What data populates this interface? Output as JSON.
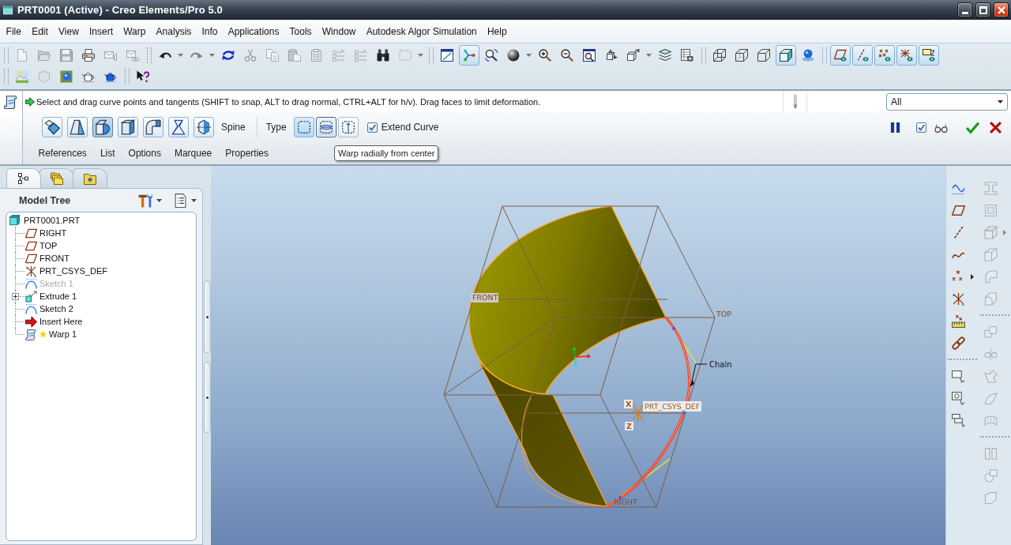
{
  "window": {
    "title": "PRT0001 (Active) - Creo Elements/Pro 5.0"
  },
  "menu": [
    "File",
    "Edit",
    "View",
    "Insert",
    "Warp",
    "Analysis",
    "Info",
    "Applications",
    "Tools",
    "Window",
    "Autodesk Algor Simulation",
    "Help"
  ],
  "toolbar_rows": [
    [
      [
        {
          "kind": "new",
          "on": false,
          "disabled": true,
          "menu": false
        },
        {
          "kind": "open",
          "on": false,
          "disabled": true,
          "menu": false
        },
        {
          "kind": "save",
          "on": false,
          "disabled": true,
          "menu": false
        },
        {
          "kind": "print",
          "on": false,
          "disabled": false,
          "menu": false
        },
        {
          "kind": "mail",
          "on": false,
          "disabled": true,
          "menu": false
        },
        {
          "kind": "mail_link",
          "on": false,
          "disabled": true,
          "menu": false
        }
      ],
      [
        {
          "kind": "undo",
          "on": false,
          "disabled": false,
          "menu": true
        },
        {
          "kind": "redo",
          "on": false,
          "disabled": true,
          "menu": true
        },
        {
          "kind": "regen",
          "on": false,
          "disabled": false,
          "menu": false
        },
        {
          "kind": "cut",
          "on": false,
          "disabled": true,
          "menu": false
        },
        {
          "kind": "copy",
          "on": false,
          "disabled": true,
          "menu": false
        },
        {
          "kind": "paste",
          "on": false,
          "disabled": true,
          "menu": false
        },
        {
          "kind": "paste_special",
          "on": false,
          "disabled": true,
          "menu": false
        },
        {
          "kind": "list_arrows",
          "on": false,
          "disabled": true,
          "menu": false
        },
        {
          "kind": "list_arrows",
          "on": false,
          "disabled": true,
          "menu": false
        },
        {
          "kind": "find",
          "on": false,
          "disabled": false,
          "menu": false
        },
        {
          "kind": "box_select",
          "on": false,
          "disabled": true,
          "menu": true
        }
      ],
      [
        {
          "kind": "repaint",
          "on": false,
          "disabled": false,
          "menu": false
        },
        {
          "kind": "spin",
          "on": true,
          "disabled": false,
          "menu": false
        },
        {
          "kind": "orient",
          "on": false,
          "disabled": false,
          "menu": false
        },
        {
          "kind": "sphere",
          "on": false,
          "disabled": false,
          "menu": true
        },
        {
          "kind": "zoom_in",
          "on": false,
          "disabled": false,
          "menu": false
        },
        {
          "kind": "zoom_out",
          "on": false,
          "disabled": false,
          "menu": false
        },
        {
          "kind": "refit",
          "on": false,
          "disabled": false,
          "menu": false
        },
        {
          "kind": "reorient",
          "on": false,
          "disabled": false,
          "menu": false
        },
        {
          "kind": "views",
          "on": false,
          "disabled": false,
          "menu": true
        },
        {
          "kind": "layers",
          "on": false,
          "disabled": false,
          "menu": false
        },
        {
          "kind": "view_mgr",
          "on": false,
          "disabled": false,
          "menu": false
        }
      ],
      [
        {
          "kind": "wire",
          "on": false,
          "disabled": false,
          "menu": false
        },
        {
          "kind": "hidden",
          "on": false,
          "disabled": false,
          "menu": false
        },
        {
          "kind": "nohidden",
          "on": false,
          "disabled": false,
          "menu": false
        },
        {
          "kind": "shaded",
          "on": true,
          "disabled": false,
          "menu": false
        },
        {
          "kind": "realism",
          "on": false,
          "disabled": false,
          "menu": false
        }
      ],
      [
        {
          "kind": "planes_on",
          "on": true,
          "disabled": false,
          "menu": false
        },
        {
          "kind": "axes_on",
          "on": true,
          "disabled": false,
          "menu": false
        },
        {
          "kind": "points_on",
          "on": true,
          "disabled": false,
          "menu": false
        },
        {
          "kind": "csys_on",
          "on": true,
          "disabled": false,
          "menu": false
        },
        {
          "kind": "notes_on",
          "on": true,
          "disabled": false,
          "menu": false
        }
      ]
    ],
    [
      [
        {
          "kind": "scene",
          "on": false,
          "disabled": false,
          "menu": false
        },
        {
          "kind": "perspective",
          "on": false,
          "disabled": true,
          "menu": false
        },
        {
          "kind": "texture",
          "on": false,
          "disabled": false,
          "menu": false
        },
        {
          "kind": "teapot",
          "on": false,
          "disabled": false,
          "menu": false
        },
        {
          "kind": "teapot_blue",
          "on": false,
          "disabled": false,
          "menu": false
        }
      ],
      [
        {
          "kind": "help",
          "on": false,
          "disabled": false,
          "menu": false
        }
      ]
    ]
  ],
  "dashboard": {
    "message": "Select and drag curve points and tangents (SHIFT to snap, ALT to drag normal, CTRL+ALT for h/v). Drag faces to limit deformation.",
    "filter": {
      "value": "All"
    },
    "tools": [
      {
        "kind": "transform",
        "selected": false
      },
      {
        "kind": "warp",
        "selected": false
      },
      {
        "kind": "spine",
        "selected": true
      },
      {
        "kind": "stretch",
        "selected": false
      },
      {
        "kind": "bend",
        "selected": false
      },
      {
        "kind": "twist",
        "selected": false
      },
      {
        "kind": "sculpt",
        "selected": false
      }
    ],
    "spine_label": "Spine",
    "type_label": "Type",
    "types": [
      {
        "kind": "box",
        "selected": true,
        "hovered": false
      },
      {
        "kind": "radial",
        "selected": false,
        "hovered": true
      },
      {
        "kind": "axial",
        "selected": false,
        "hovered": false
      }
    ],
    "extend_curve": {
      "label": "Extend Curve",
      "checked": true
    },
    "actions": [
      {
        "kind": "pause"
      },
      {
        "kind": "preview",
        "checked": true
      },
      {
        "kind": "verify"
      },
      {
        "kind": "apply"
      },
      {
        "kind": "cancel"
      }
    ],
    "tabs": [
      {
        "label": "References",
        "selected": false
      },
      {
        "label": "List",
        "selected": false
      },
      {
        "label": "Options",
        "selected": false
      },
      {
        "label": "Marquee",
        "selected": false
      },
      {
        "label": "Properties",
        "selected": false
      }
    ],
    "tooltip": "Warp radially from center"
  },
  "model_tree": {
    "tabs": [
      {
        "kind": "tree",
        "selected": true
      },
      {
        "kind": "folders",
        "selected": false
      },
      {
        "kind": "favorites",
        "selected": false
      }
    ],
    "title": "Model Tree",
    "items": [
      {
        "label": "PRT0001.PRT",
        "kind": "part",
        "disabled": false,
        "active": false,
        "children": [
          {
            "label": "RIGHT",
            "kind": "plane",
            "disabled": false,
            "active": false
          },
          {
            "label": "TOP",
            "kind": "plane",
            "disabled": false,
            "active": false
          },
          {
            "label": "FRONT",
            "kind": "plane",
            "disabled": false,
            "active": false
          },
          {
            "label": "PRT_CSYS_DEF",
            "kind": "csys",
            "disabled": false,
            "active": false
          },
          {
            "label": "Sketch 1",
            "kind": "sketch",
            "disabled": true,
            "active": false
          },
          {
            "label": "Extrude 1",
            "kind": "extrude",
            "disabled": false,
            "active": false,
            "expanded": false
          },
          {
            "label": "Sketch 2",
            "kind": "sketch",
            "disabled": false,
            "active": false
          },
          {
            "label": "Insert Here",
            "kind": "insert",
            "disabled": false,
            "active": false
          },
          {
            "label": "Warp 1",
            "kind": "warp",
            "disabled": false,
            "active": true
          }
        ]
      }
    ]
  },
  "viewport": {
    "datum_labels": [
      "FRONT",
      "TOP",
      "RIGHT"
    ],
    "csys_label": "PRT_CSYS_DEF",
    "csys_axes": [
      "X",
      "Z"
    ],
    "callout": "Chain"
  },
  "right_toolbar": [
    [
      [
        {
          "kind": "sketch",
          "disabled": false,
          "flyout": false
        },
        {
          "kind": "plane",
          "disabled": false,
          "flyout": false
        },
        {
          "kind": "axis",
          "disabled": false,
          "flyout": false
        },
        {
          "kind": "curve",
          "disabled": false,
          "flyout": false
        },
        {
          "kind": "points",
          "disabled": false,
          "flyout": true
        },
        {
          "kind": "csys",
          "disabled": false,
          "flyout": false
        },
        {
          "kind": "analysis",
          "disabled": false,
          "flyout": false
        },
        {
          "kind": "chain",
          "disabled": false,
          "flyout": false
        }
      ],
      [
        {
          "kind": "note_box",
          "disabled": false,
          "flyout": false
        },
        {
          "kind": "note_pic",
          "disabled": false,
          "flyout": false
        },
        {
          "kind": "note_stack",
          "disabled": false,
          "flyout": false
        }
      ]
    ],
    [
      [
        {
          "kind": "beam",
          "disabled": true,
          "flyout": false
        },
        {
          "kind": "frame_box",
          "disabled": true,
          "flyout": false
        },
        {
          "kind": "box",
          "disabled": true,
          "flyout": true
        },
        {
          "kind": "wedge",
          "disabled": true,
          "flyout": false
        },
        {
          "kind": "arc_block",
          "disabled": true,
          "flyout": false
        },
        {
          "kind": "round_block",
          "disabled": true,
          "flyout": false
        }
      ],
      [
        {
          "kind": "stack_boxes",
          "disabled": true,
          "flyout": false
        },
        {
          "kind": "mirror",
          "disabled": true,
          "flyout": false
        },
        {
          "kind": "merge",
          "disabled": true,
          "flyout": false
        },
        {
          "kind": "patch",
          "disabled": true,
          "flyout": false
        },
        {
          "kind": "cyl_patch",
          "disabled": true,
          "flyout": false
        }
      ],
      [
        {
          "kind": "split",
          "disabled": true,
          "flyout": false
        },
        {
          "kind": "circles",
          "disabled": true,
          "flyout": false
        },
        {
          "kind": "folded",
          "disabled": true,
          "flyout": false
        }
      ]
    ]
  ]
}
